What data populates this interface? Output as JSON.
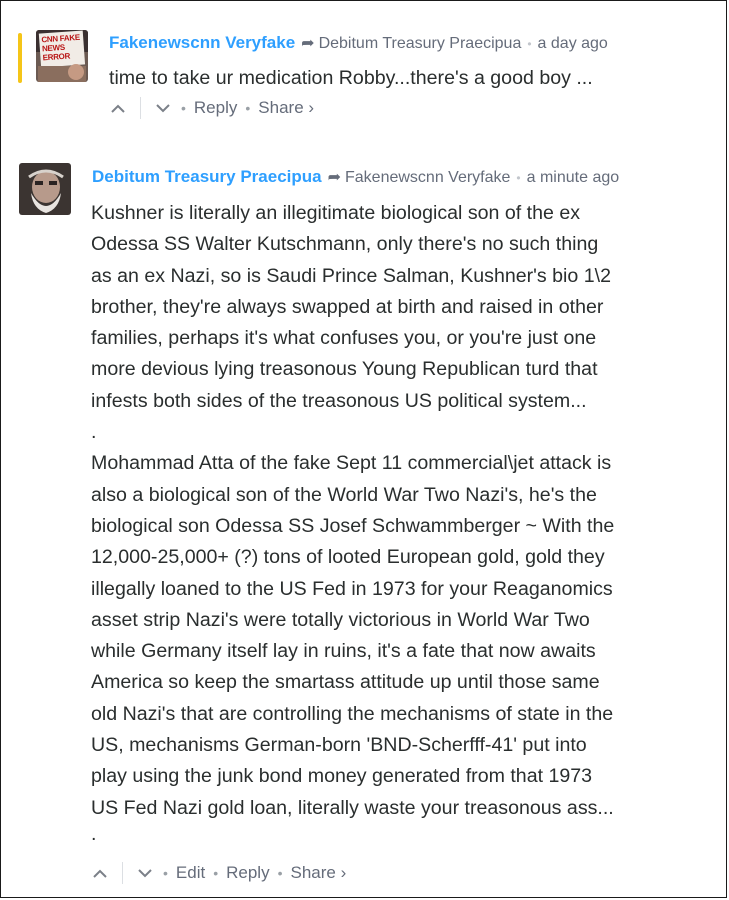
{
  "comments": [
    {
      "author": "Fakenewscnn Veryfake",
      "reply_to": "Debitum Treasury Praecipua",
      "time": "a day ago",
      "avatar_text": "CNN FAKE NEWS ERROR",
      "body": [
        "time to take ur medication Robby...there's a good boy ..."
      ],
      "actions": [
        "Reply",
        "Share ›"
      ]
    },
    {
      "author": "Debitum Treasury Praecipua",
      "reply_to": "Fakenewscnn Veryfake",
      "time": "a minute ago",
      "body": [
        "Kushner is literally an illegitimate biological son of the ex",
        "Odessa SS Walter Kutschmann, only there's no such thing",
        "as an ex Nazi, so is Saudi Prince Salman, Kushner's bio 1\\2",
        "brother, they're always swapped at birth and raised in other",
        "families, perhaps it's what confuses you, or you're just one",
        "more devious lying treasonous Young Republican turd that",
        "infests both sides of the treasonous US political system...",
        ".",
        "Mohammad Atta of the fake Sept 11 commercial\\jet attack is",
        "also a biological son of the World War Two Nazi's, he's the",
        "biological son Odessa SS Josef Schwammberger ~ With the",
        "12,000-25,000+ (?) tons of looted European gold, gold they",
        "illegally loaned to the US Fed in 1973 for your Reaganomics",
        "asset strip Nazi's were totally victorious in World War Two",
        "while Germany itself lay in ruins, it's a fate that now awaits",
        "America so keep the smartass attitude up until those same",
        "old Nazi's that are controlling the mechanisms of state in the",
        "US, mechanisms German-born 'BND-Scherfff-41' put into",
        "play using the junk bond money generated from that 1973",
        "US Fed Nazi gold loan, literally waste your treasonous ass...",
        "."
      ],
      "actions": [
        "Edit",
        "Reply",
        "Share ›"
      ]
    }
  ]
}
